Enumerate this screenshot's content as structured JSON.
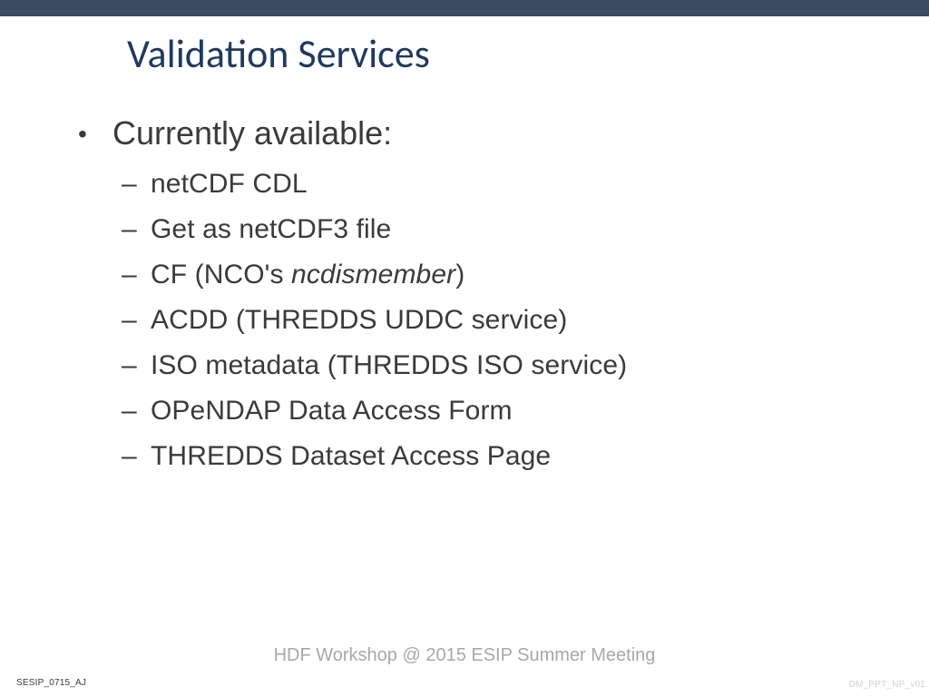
{
  "title": "Validation Services",
  "heading": "Currently available:",
  "items": [
    {
      "text": "netCDF CDL"
    },
    {
      "text": "Get as netCDF3 file"
    },
    {
      "prefix": "CF (NCO's ",
      "italic": "ncdismember",
      "suffix": ")"
    },
    {
      "text": "ACDD (THREDDS UDDC service)"
    },
    {
      "text": "ISO metadata (THREDDS ISO service)"
    },
    {
      "text": "OPeNDAP Data Access Form"
    },
    {
      "text": "THREDDS Dataset Access Page"
    }
  ],
  "footer_center": "HDF Workshop @ 2015 ESIP Summer Meeting",
  "footer_left": "SESIP_0715_AJ",
  "footer_right": "DM_PPT_NP_v01"
}
